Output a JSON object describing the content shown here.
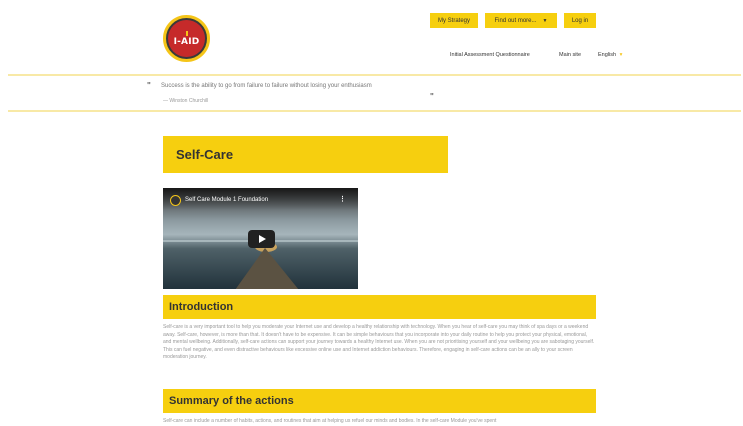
{
  "logo": {
    "text": "I-AID"
  },
  "header": {
    "buttons": {
      "strategy": "My Strategy",
      "find_out_more": "Find out more...",
      "login": "Log in"
    },
    "nav": {
      "questionnaire": "Initial Assessment Questionnaire",
      "main_site": "Main site",
      "language": "English"
    }
  },
  "quote": {
    "text": "Success is the ability to go from failure to failure without losing your enthusiasm",
    "author": "— Winston Churchill"
  },
  "page": {
    "title": "Self-Care"
  },
  "video": {
    "title": "Self Care Module 1 Foundation"
  },
  "sections": {
    "introduction": {
      "heading": "Introduction",
      "text": "Self-care is a very important tool to help you moderate your Internet use and develop a healthy relationship with technology. When you hear of self-care you may think of spa days or a weekend away. Self-care, however, is more than that. It doesn't have to be expensive. It can be simple behaviours that you incorporate into your daily routine to help you protect your physical, emotional, and mental wellbeing. Additionally, self-care actions can support your journey towards a healthy Internet use. When you are not prioritising yourself and your wellbeing you are sabotaging yourself. This can fuel negative, and even distractive behaviours like excessive online use and Internet addiction behaviours. Therefore, engaging in self-care actions can be an ally to your screen moderation journey."
    },
    "summary": {
      "heading": "Summary of the actions",
      "text": "Self-care can include a number of habits, actions, and routines that aim at helping us refuel our minds and bodies. In the self-care Module you've spent"
    }
  },
  "colors": {
    "accent": "#f6cf0f",
    "logo_red": "#c62a2a",
    "quote_border": "#f8e9a6"
  }
}
